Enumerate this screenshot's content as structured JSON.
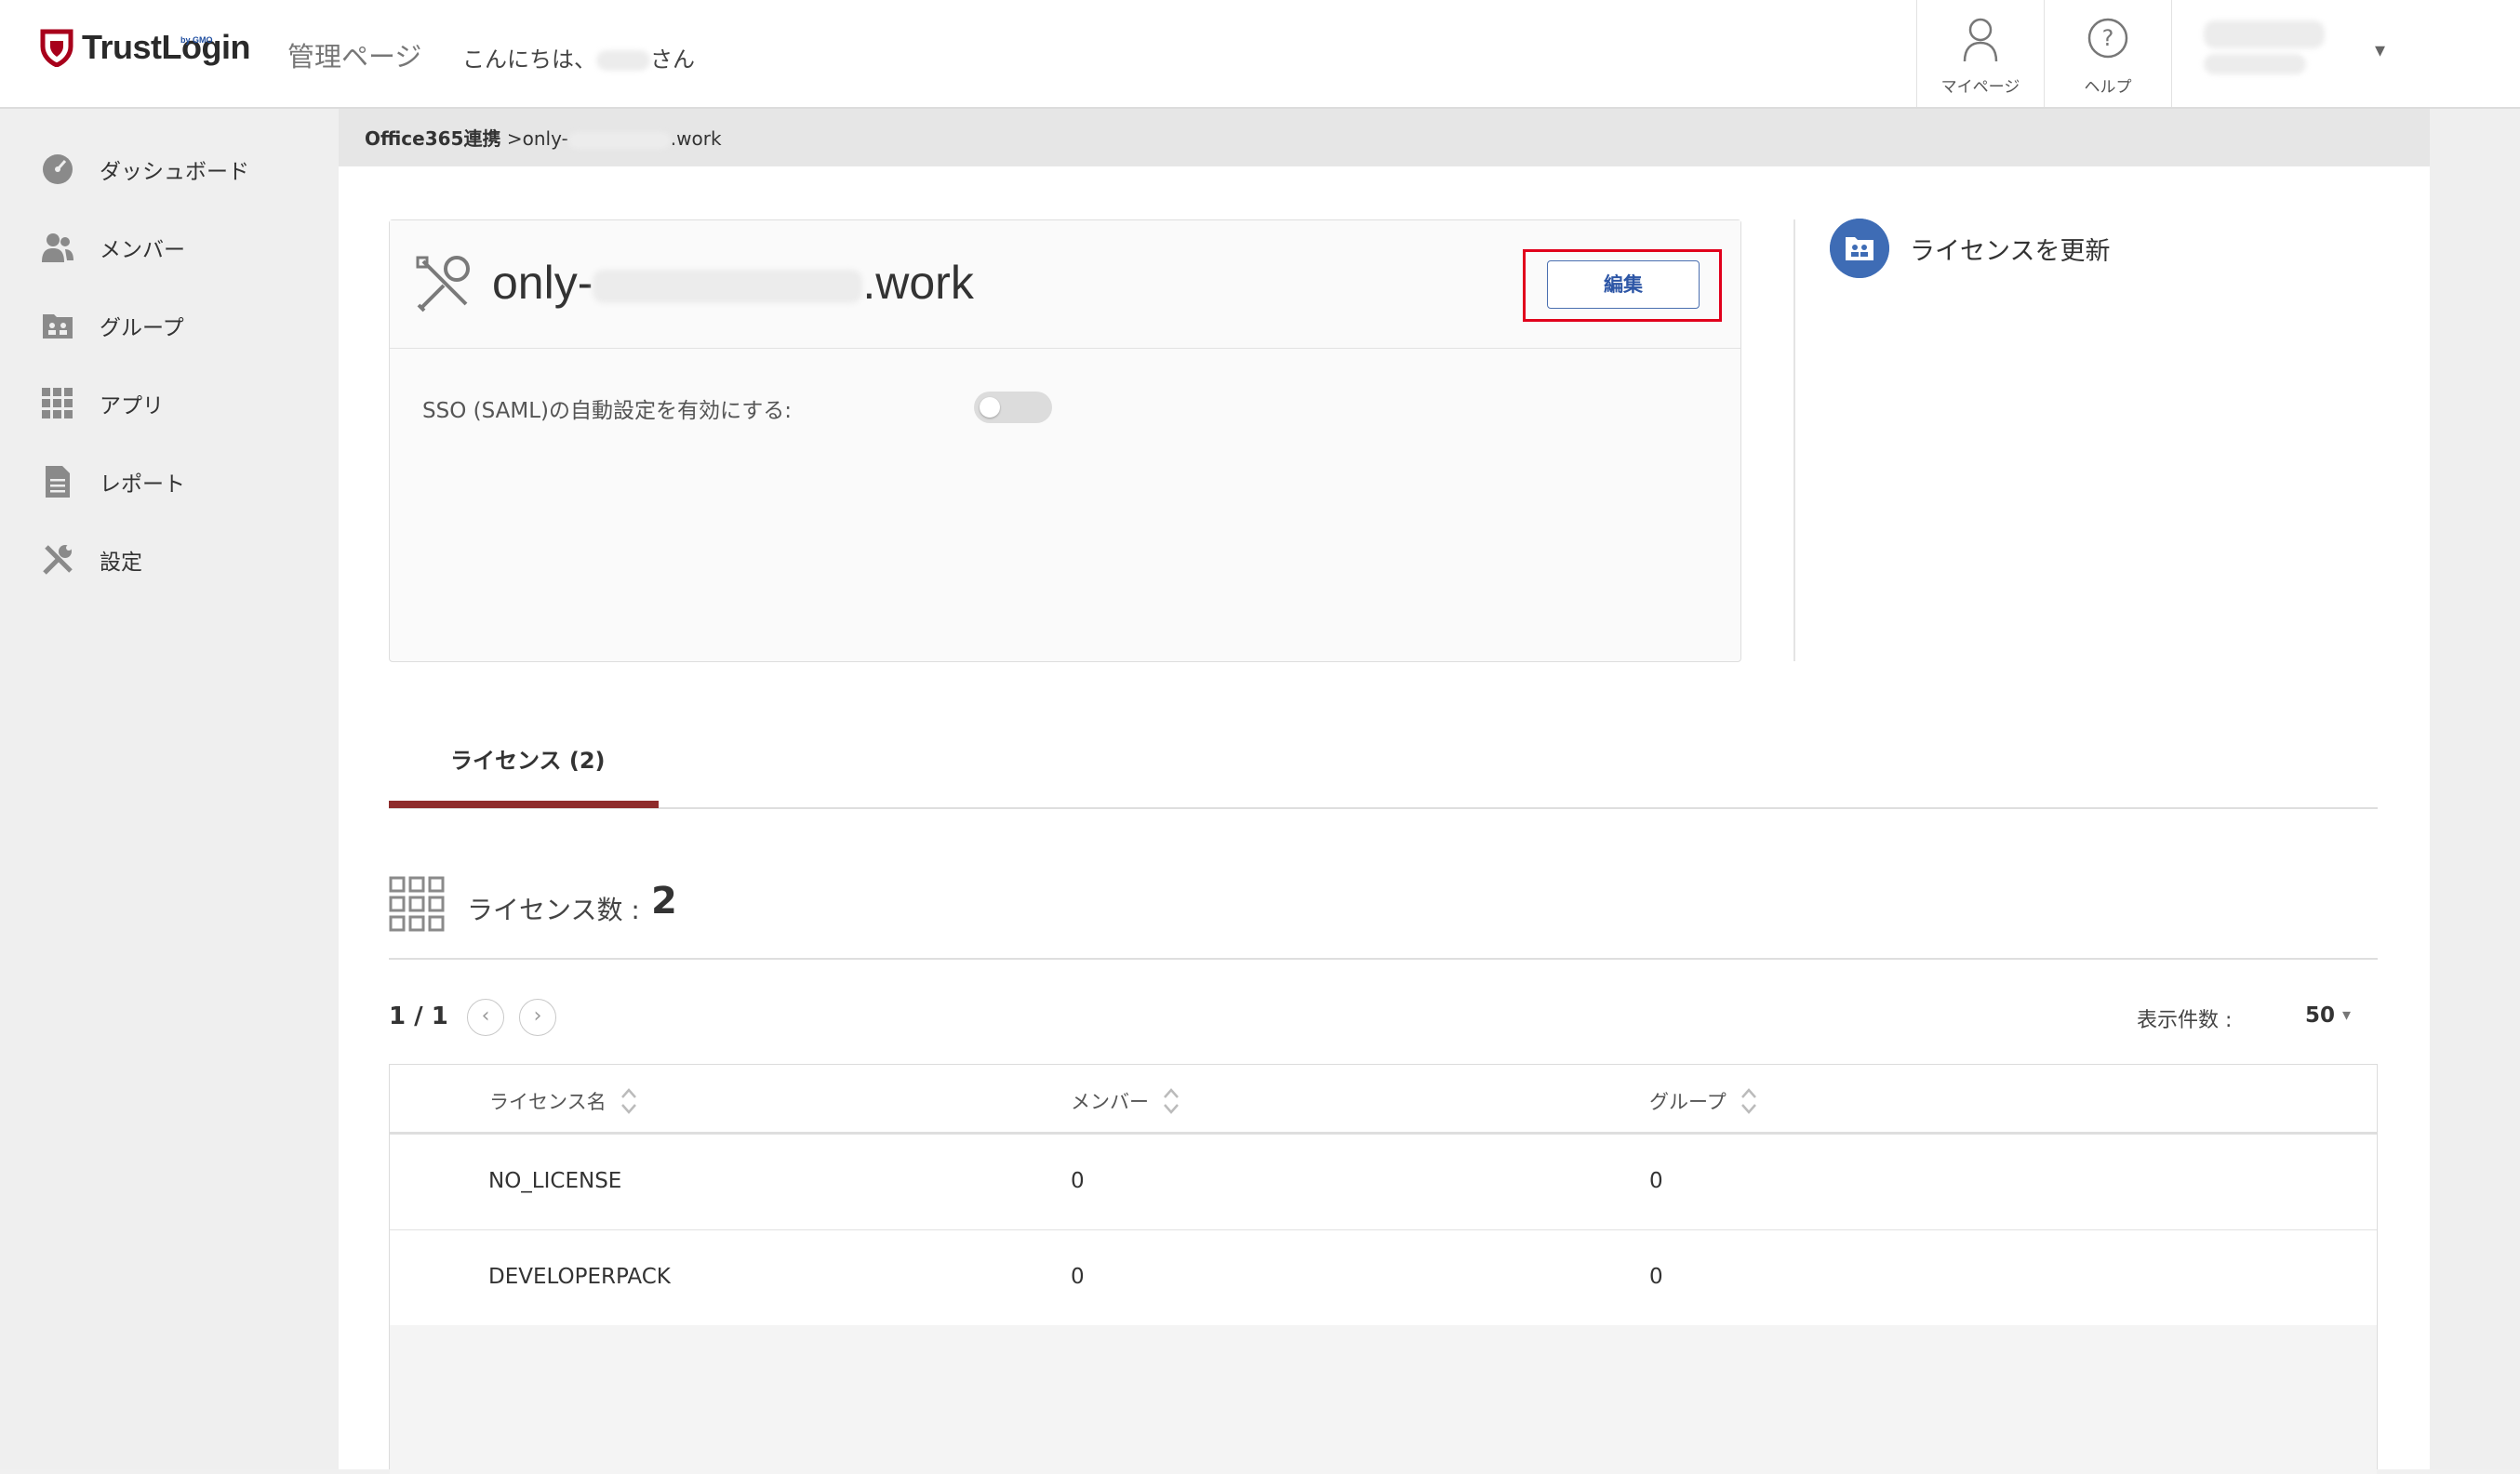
{
  "header": {
    "logo_text": "TrustLogin",
    "logo_sub": "by GMO",
    "admin_title": "管理ページ",
    "greeting_prefix": "こんにちは、",
    "greeting_suffix": "さん",
    "mypage_label": "マイページ",
    "help_label": "ヘルプ"
  },
  "sidebar": {
    "items": [
      {
        "label": "ダッシュボード",
        "icon": "dashboard-icon"
      },
      {
        "label": "メンバー",
        "icon": "members-icon"
      },
      {
        "label": "グループ",
        "icon": "group-icon"
      },
      {
        "label": "アプリ",
        "icon": "apps-grid-icon"
      },
      {
        "label": "レポート",
        "icon": "report-icon"
      },
      {
        "label": "設定",
        "icon": "settings-tools-icon"
      }
    ]
  },
  "breadcrumb": {
    "parent": "Office365連携",
    "separator": " >",
    "current_prefix": "only-",
    "current_suffix": ".work"
  },
  "app_card": {
    "title_prefix": "only-",
    "title_suffix": ".work",
    "edit_label": "編集",
    "sso_label": "SSO (SAML)の自動設定を有効にする:",
    "sso_enabled": false
  },
  "side_action": {
    "update_license_label": "ライセンスを更新"
  },
  "tabs": [
    {
      "label": "ライセンス (2)",
      "active": true
    }
  ],
  "license_summary": {
    "label": "ライセンス数 :",
    "count": "2"
  },
  "pagination": {
    "page": "1 / 1",
    "per_page_label": "表示件数 :",
    "per_page_value": "50"
  },
  "table": {
    "columns": [
      "ライセンス名",
      "メンバー",
      "グループ"
    ],
    "rows": [
      [
        "NO_LICENSE",
        "0",
        "0"
      ],
      [
        "DEVELOPERPACK",
        "0",
        "0"
      ]
    ]
  },
  "colors": {
    "accent_red": "#8e2c2c",
    "highlight_red": "#e1001c",
    "primary_blue": "#3e6cb5"
  }
}
